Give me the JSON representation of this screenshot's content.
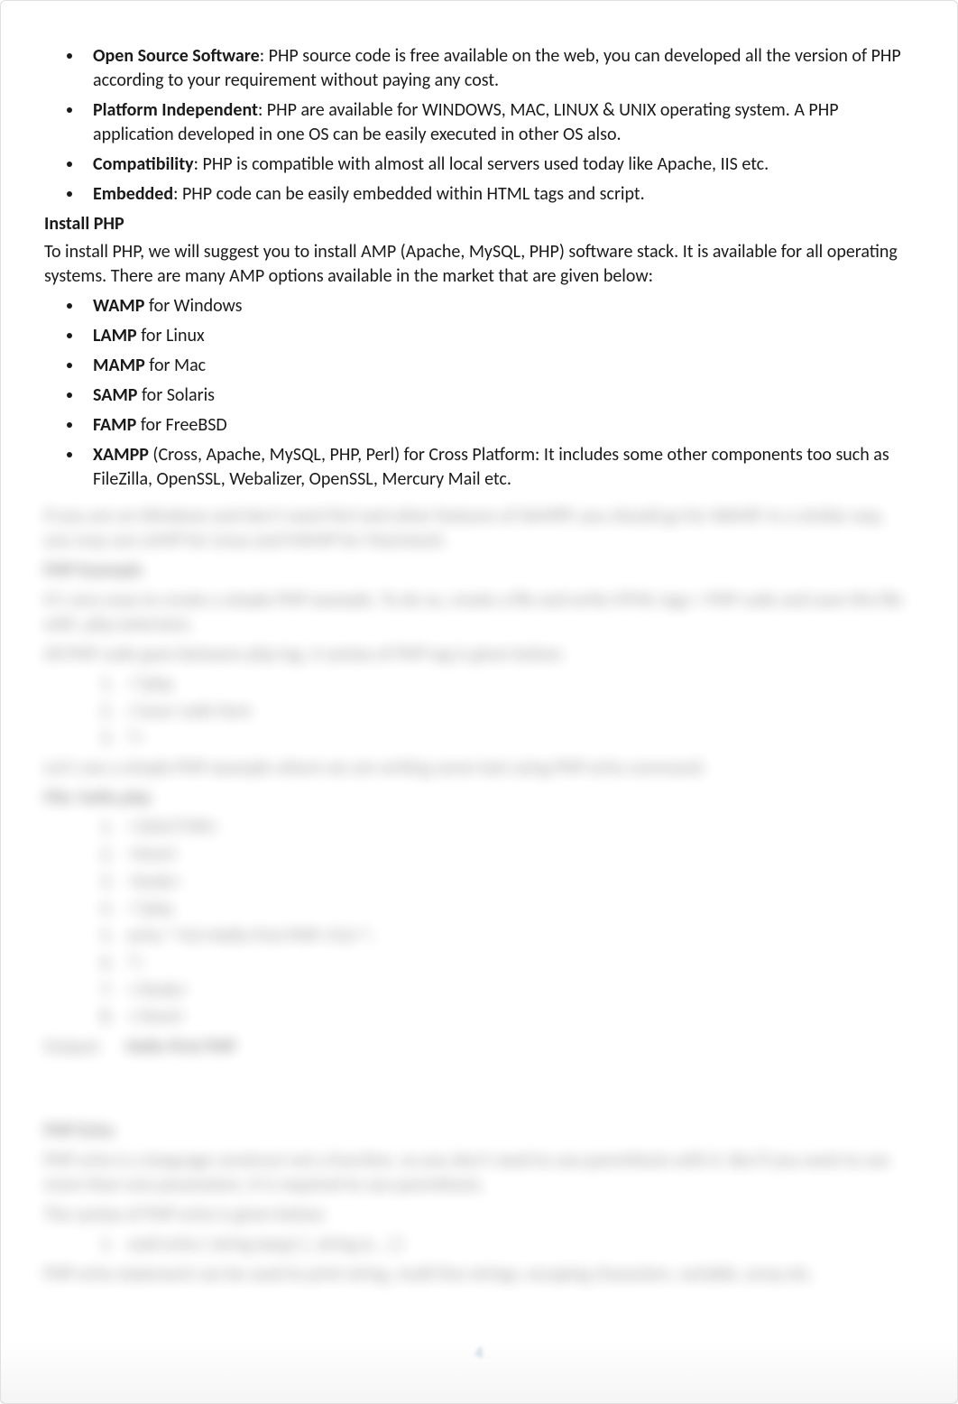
{
  "bullets_top": [
    {
      "bold": "Open Source Software",
      "rest": ": PHP source code is free available on the web, you can developed all the version of PHP according to your requirement without paying any cost."
    },
    {
      "bold": "Platform Independent",
      "rest": ": PHP are available for WINDOWS, MAC, LINUX & UNIX operating system. A PHP application developed in one OS can be easily executed in other OS also."
    },
    {
      "bold": "Compatibility",
      "rest": ": PHP is compatible with almost all local servers used today like Apache, IIS etc."
    },
    {
      "bold": "Embedded",
      "rest": ": PHP code can be easily embedded within HTML tags and script."
    }
  ],
  "install_heading": "Install PHP",
  "install_para": "To install PHP, we will suggest you to install AMP (Apache, MySQL, PHP) software stack. It is available for all operating systems. There are many AMP options available in the market that are given below:",
  "amp_list": [
    {
      "bold": "WAMP",
      "rest": " for Windows"
    },
    {
      "bold": "LAMP",
      "rest": " for Linux"
    },
    {
      "bold": "MAMP",
      "rest": " for Mac"
    },
    {
      "bold": "SAMP",
      "rest": " for Solaris"
    },
    {
      "bold": "FAMP",
      "rest": " for FreeBSD"
    },
    {
      "bold": "XAMPP",
      "rest": " (Cross, Apache, MySQL, PHP, Perl) for Cross Platform: It includes some other components too such as FileZilla, OpenSSL, Webalizer, OpenSSL, Mercury Mail etc."
    }
  ],
  "blurred": {
    "line1": "If you are on Windows and don't want Perl and other features of XAMPP, you should go for WAMP. In a similar way, you may use LAMP for Linux and MAMP for Macintosh.",
    "heading1": "PHP Example",
    "line2": "It's very easy to create a simple PHP example. To do so, create a file and write HTML tags + PHP code and save this file with .php extension.",
    "line3": "All PHP code goes between php tag. A syntax of PHP tag is given below:",
    "code1": [
      "<?php",
      "//your code here",
      "?>"
    ],
    "line4": "Let's see a simple PHP example where we are writing some text using PHP echo command.",
    "filename": "File: hello.php",
    "code2": [
      "<!DOCTYPE>",
      "<html>",
      "<body>",
      "<?php",
      "echo \"<h2>Hello First PHP</h2>\";",
      "?>",
      "</body>",
      "</html>"
    ],
    "output_label": "Output:",
    "output_value": "Hello First PHP",
    "heading2": "PHP Echo",
    "echo1": "PHP echo is a language construct not a function, so you don't need to use parenthesis with it. But if you want to use more than one parameters, it is required to use parenthesis.",
    "echo2": "The syntax of PHP echo is given below:",
    "echo_syntax": "void echo ( string $arg1 [, string $... ] )",
    "echo3": "PHP echo statement can be used to print string, multi line strings, escaping characters, variable, array etc."
  },
  "page_number": "4"
}
